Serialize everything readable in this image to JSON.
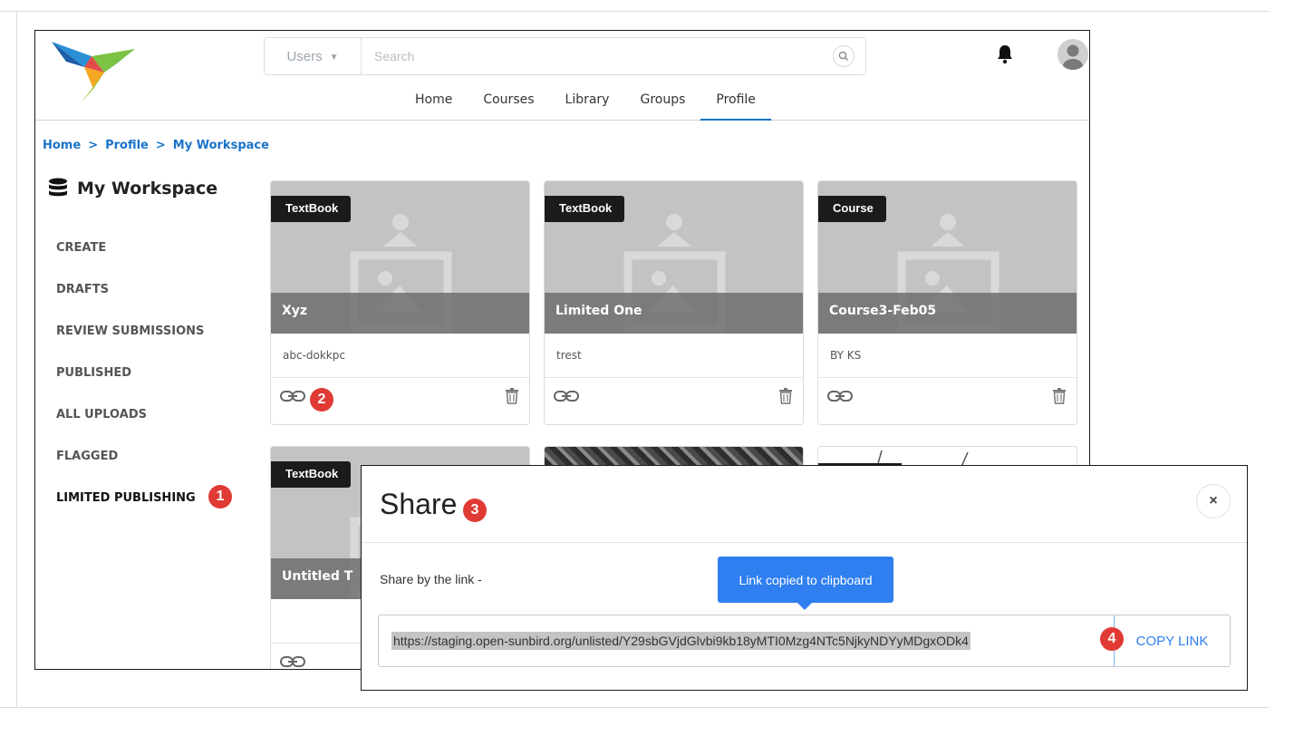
{
  "header": {
    "search_category": "Users",
    "search_placeholder": "Search"
  },
  "nav": {
    "items": [
      {
        "label": "Home"
      },
      {
        "label": "Courses"
      },
      {
        "label": "Library"
      },
      {
        "label": "Groups"
      },
      {
        "label": "Profile"
      }
    ],
    "active": "Profile"
  },
  "breadcrumb": {
    "items": [
      "Home",
      "Profile",
      "My Workspace"
    ],
    "separator": ">"
  },
  "sidebar": {
    "title": "My Workspace",
    "items": [
      {
        "label": "CREATE"
      },
      {
        "label": "DRAFTS"
      },
      {
        "label": "REVIEW SUBMISSIONS"
      },
      {
        "label": "PUBLISHED"
      },
      {
        "label": "ALL UPLOADS"
      },
      {
        "label": "FLAGGED"
      },
      {
        "label": "LIMITED PUBLISHING"
      }
    ],
    "active": "LIMITED PUBLISHING"
  },
  "cards": [
    {
      "badge": "TextBook",
      "title": "Xyz",
      "subtitle": "abc-dokkpc"
    },
    {
      "badge": "TextBook",
      "title": "Limited One",
      "subtitle": "trest"
    },
    {
      "badge": "Course",
      "title": "Course3-Feb05",
      "subtitle": "BY KS"
    },
    {
      "badge": "TextBook",
      "title": "Untitled T",
      "subtitle": ""
    }
  ],
  "annotations": [
    "1",
    "2",
    "3",
    "4"
  ],
  "modal": {
    "title": "Share",
    "close_label": "×",
    "share_label": "Share by the link -",
    "tooltip": "Link copied to clipboard",
    "link": "https://staging.open-sunbird.org/unlisted/Y29sbGVjdGlvbi9kb18yMTI0Mzg4NTc5NjkyNDYyMDgxODk4",
    "copy_button": "COPY LINK"
  },
  "colors": {
    "accent": "#1a73c8",
    "tooltip": "#2f7ff0",
    "annotation": "#e03a34",
    "badge": "#1b1b1b"
  }
}
